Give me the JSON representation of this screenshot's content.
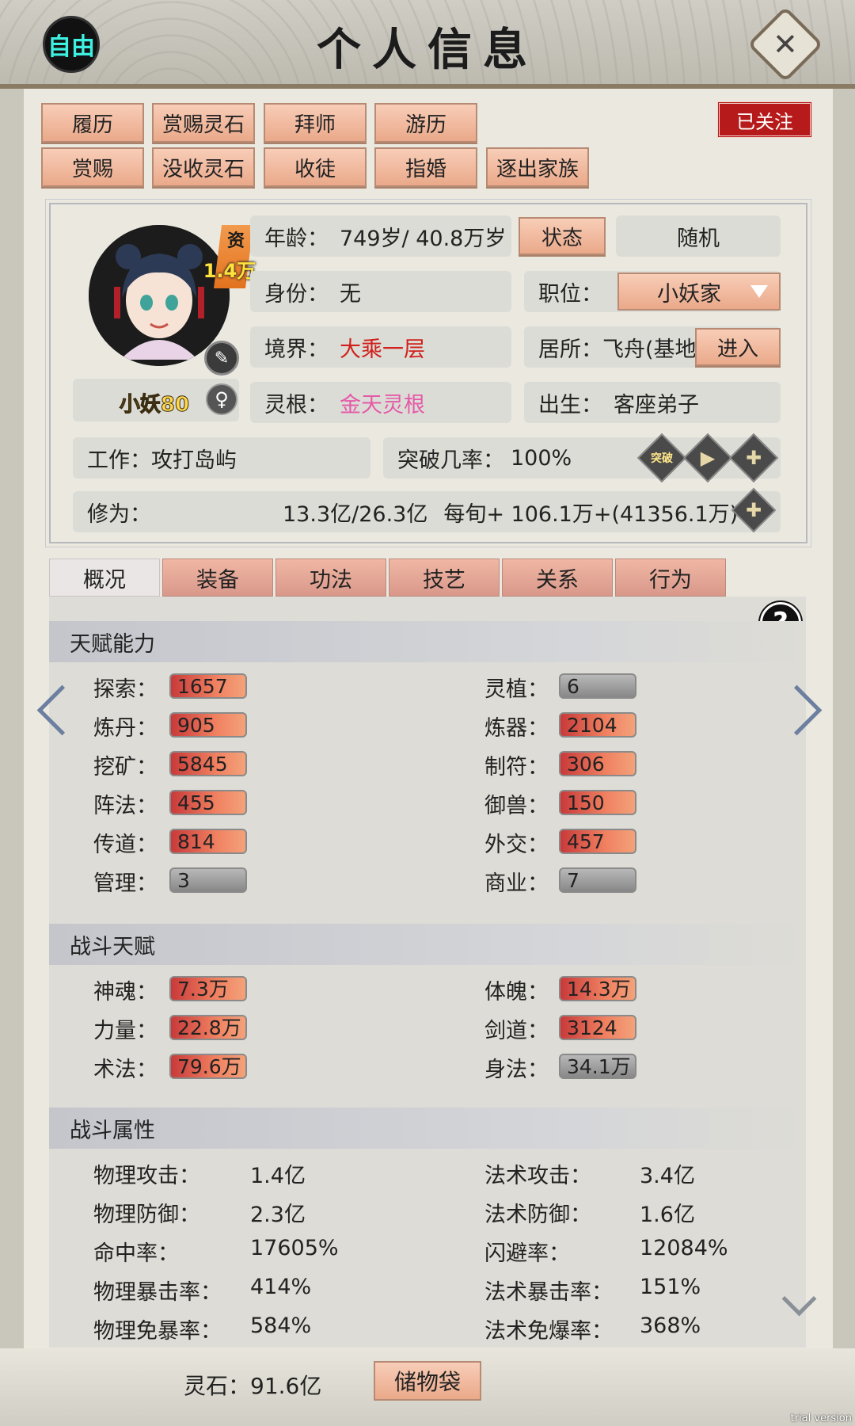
{
  "header": {
    "title": "个人信息",
    "free_label": "自由",
    "close_icon": "close-icon"
  },
  "actions_row1": [
    "履历",
    "赏赐灵石",
    "拜师",
    "游历"
  ],
  "actions_row2": [
    "赏赐",
    "没收灵石",
    "收徒",
    "指婚",
    "逐出家族"
  ],
  "followed_label": "已关注",
  "profile": {
    "zi_label": "资",
    "zi_value": "1.4万",
    "name": "小妖80",
    "gender_icon": "female-icon",
    "age_label": "年龄：",
    "age_value": "749岁/ 40.8万岁",
    "state_button": "状态",
    "random_button": "随机",
    "identity_label": "身份：",
    "identity_value": "无",
    "position_label": "职位：",
    "position_value": "小妖家",
    "realm_label": "境界：",
    "realm_value": "大乘一层",
    "residence_label": "居所：",
    "residence_value": "飞舟(基地",
    "enter_button": "进入",
    "root_label": "灵根：",
    "root_value": "金天灵根",
    "birth_label": "出生：",
    "birth_value": "客座弟子",
    "work_label": "工作：",
    "work_value": "攻打岛屿",
    "breakthrough_label": "突破几率：",
    "breakthrough_value": "100%",
    "breakthrough_icon": "突破",
    "cultivation_label": "修为：",
    "cultivation_value": "13.3亿/26.3亿",
    "cultivation_rate": "每旬+  106.1万+(41356.1",
    "cultivation_rate_tail": "万)"
  },
  "tabs": [
    "概况",
    "装备",
    "功法",
    "技艺",
    "关系",
    "行为"
  ],
  "sections": {
    "talent": "天赋能力",
    "combat_talent": "战斗天赋",
    "combat_attr": "战斗属性"
  },
  "talent_left": [
    {
      "label": "探索：",
      "value": "1657",
      "hot": true
    },
    {
      "label": "炼丹：",
      "value": "905",
      "hot": true
    },
    {
      "label": "挖矿：",
      "value": "5845",
      "hot": true
    },
    {
      "label": "阵法：",
      "value": "455",
      "hot": true
    },
    {
      "label": "传道：",
      "value": "814",
      "hot": true
    },
    {
      "label": "管理：",
      "value": "3",
      "hot": false
    }
  ],
  "talent_right": [
    {
      "label": "灵植：",
      "value": "6",
      "hot": false
    },
    {
      "label": "炼器：",
      "value": "2104",
      "hot": true
    },
    {
      "label": "制符：",
      "value": "306",
      "hot": true
    },
    {
      "label": "御兽：",
      "value": "150",
      "hot": true
    },
    {
      "label": "外交：",
      "value": "457",
      "hot": true
    },
    {
      "label": "商业：",
      "value": "7",
      "hot": false
    }
  ],
  "combat_left": [
    {
      "label": "神魂：",
      "value": "7.3万",
      "hot": true
    },
    {
      "label": "力量：",
      "value": "22.8万",
      "hot": true
    },
    {
      "label": "术法：",
      "value": "79.6万",
      "hot": true
    }
  ],
  "combat_right": [
    {
      "label": "体魄：",
      "value": "14.3万",
      "hot": true
    },
    {
      "label": "剑道：",
      "value": "3124",
      "hot": true
    },
    {
      "label": "身法：",
      "value": "34.1万",
      "hot": false
    }
  ],
  "attr_left": [
    {
      "label": "物理攻击：",
      "value": "1.4亿"
    },
    {
      "label": "物理防御：",
      "value": "2.3亿"
    },
    {
      "label": "命中率：",
      "value": "17605%"
    },
    {
      "label": "物理暴击率：",
      "value": "414%"
    },
    {
      "label": "物理免暴率：",
      "value": "584%"
    }
  ],
  "attr_right": [
    {
      "label": "法术攻击：",
      "value": "3.4亿"
    },
    {
      "label": "法术防御：",
      "value": "1.6亿"
    },
    {
      "label": "闪避率：",
      "value": "12084%"
    },
    {
      "label": "法术暴击率：",
      "value": "151%"
    },
    {
      "label": "法术免爆率：",
      "value": "368%"
    }
  ],
  "footer": {
    "spirit_stone_label": "灵石：",
    "spirit_stone_value": "91.6亿",
    "bag_button": "储物袋",
    "trial": "trial version"
  }
}
